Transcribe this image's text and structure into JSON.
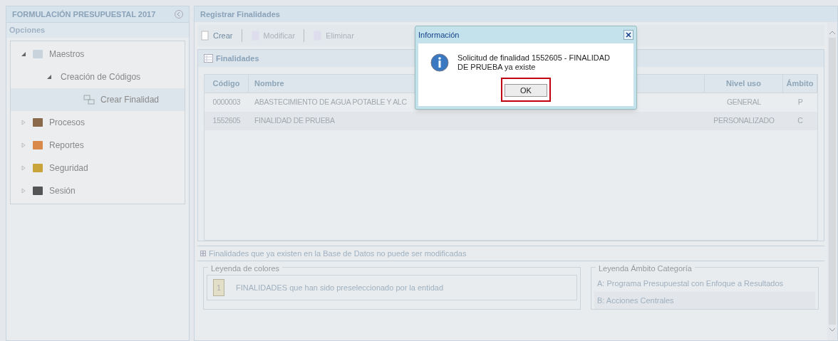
{
  "sidebar": {
    "title": "FORMULACIÓN PRESUPUESTAL 2017",
    "section": "Opciones",
    "tree": [
      {
        "label": "Maestros",
        "expanded": true,
        "selected": false,
        "children": [
          {
            "label": "Creación de Códigos",
            "expanded": true,
            "selected": false,
            "children": [
              {
                "label": "Crear Finalidad",
                "selected": true
              }
            ]
          }
        ]
      },
      {
        "label": "Procesos",
        "expanded": false,
        "selected": false
      },
      {
        "label": "Reportes",
        "expanded": false,
        "selected": false
      },
      {
        "label": "Seguridad",
        "expanded": false,
        "selected": false
      },
      {
        "label": "Sesión",
        "expanded": false,
        "selected": false
      }
    ]
  },
  "main": {
    "title": "Registrar Finalidades",
    "toolbar": [
      {
        "label": "Crear",
        "disabled": false
      },
      {
        "label": "Modificar",
        "disabled": true
      },
      {
        "label": "Eliminar",
        "disabled": true
      }
    ],
    "grid": {
      "title": "Finalidades",
      "columns": [
        "Código",
        "Nombre",
        "Nivel uso",
        "Ámbito"
      ],
      "rows": [
        {
          "cells": [
            "0000003",
            "ABASTECIMIENTO DE AGUA POTABLE Y ALC",
            "GENERAL",
            "P"
          ]
        },
        {
          "cells": [
            "1552605",
            "FINALIDAD DE PRUEBA",
            "PERSONALIZADO",
            "C"
          ]
        }
      ]
    },
    "note": "Finalidades que ya existen en la Base de Datos no puede ser modificadas",
    "color_legend": {
      "title": "Leyenda de colores",
      "items": [
        {
          "swatch": "1",
          "label": "FINALIDADES que han sido preseleccionado por la entidad"
        }
      ]
    },
    "scope_legend": {
      "title": "Leyenda Ámbito Categoría",
      "items": [
        "A: Programa Presupuestal con Enfoque a Resultados",
        "B: Acciones Centrales"
      ]
    }
  },
  "dialog": {
    "title": "Información",
    "message": "Solicitud de finalidad 1552605 - FINALIDAD DE PRUEBA ya existe",
    "button": "OK"
  }
}
